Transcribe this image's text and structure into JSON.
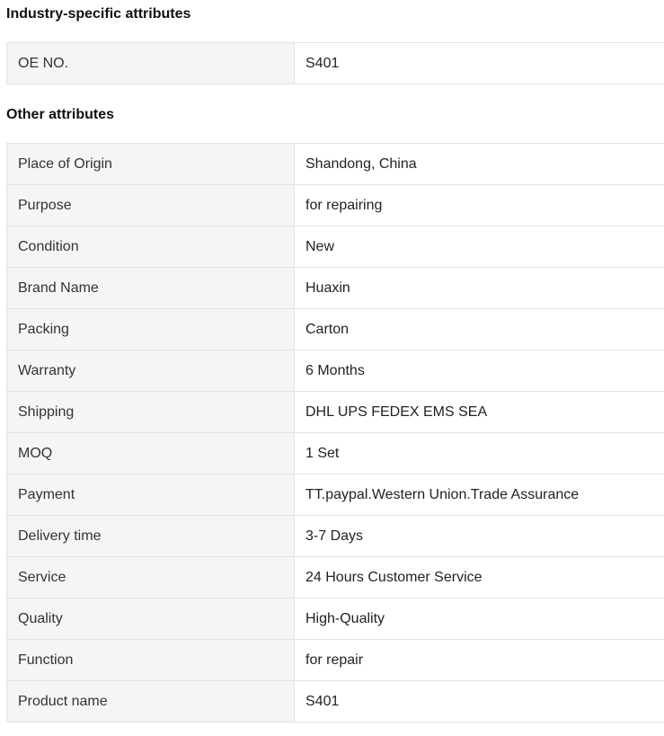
{
  "industry_section": {
    "title": "Industry-specific attributes",
    "rows": [
      {
        "label": "OE NO.",
        "value": "S401"
      }
    ]
  },
  "other_section": {
    "title": "Other attributes",
    "rows": [
      {
        "label": "Place of Origin",
        "value": "Shandong, China"
      },
      {
        "label": "Purpose",
        "value": "for repairing"
      },
      {
        "label": "Condition",
        "value": "New"
      },
      {
        "label": "Brand Name",
        "value": "Huaxin"
      },
      {
        "label": "Packing",
        "value": "Carton"
      },
      {
        "label": "Warranty",
        "value": "6 Months"
      },
      {
        "label": "Shipping",
        "value": "DHL UPS FEDEX EMS SEA"
      },
      {
        "label": "MOQ",
        "value": "1 Set"
      },
      {
        "label": "Payment",
        "value": "TT.paypal.Western Union.Trade Assurance"
      },
      {
        "label": "Delivery time",
        "value": "3-7 Days"
      },
      {
        "label": "Service",
        "value": "24 Hours Customer Service"
      },
      {
        "label": "Quality",
        "value": "High-Quality"
      },
      {
        "label": "Function",
        "value": "for repair"
      },
      {
        "label": "Product name",
        "value": "S401"
      }
    ]
  },
  "colors": {
    "label_background": "#f5f5f5",
    "border": "#e3e3e3",
    "text": "#222222"
  }
}
